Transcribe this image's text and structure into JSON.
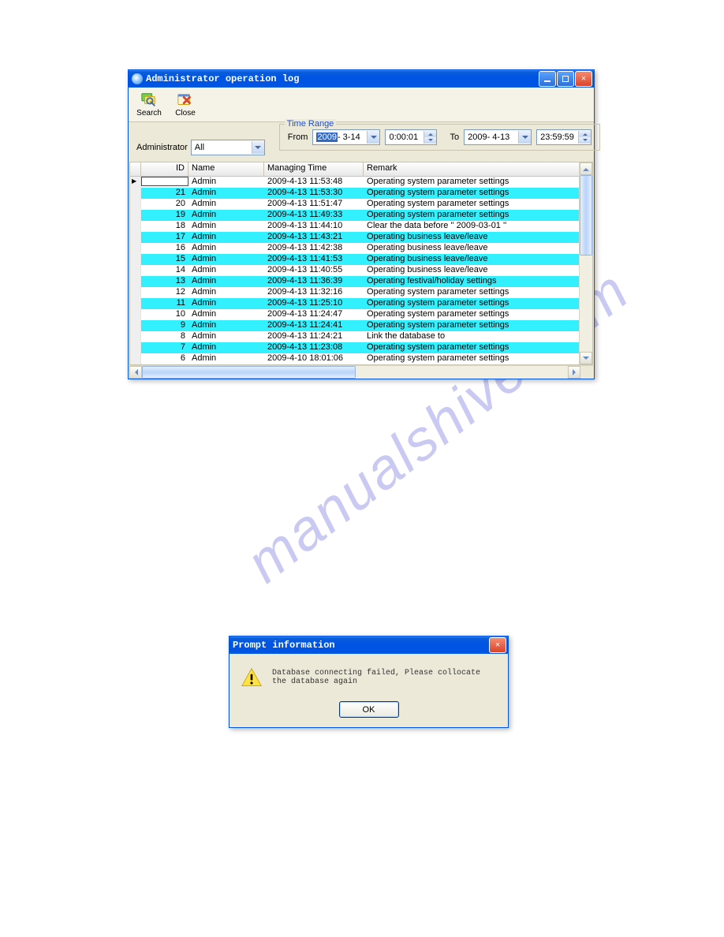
{
  "watermark": "manualshive.com",
  "mainWindow": {
    "title": "Administrator operation log",
    "toolbar": {
      "search": "Search",
      "close": "Close"
    },
    "filters": {
      "adminLabel": "Administrator",
      "adminValue": "All",
      "timeRangeLegend": "Time Range",
      "fromLabel": "From",
      "fromDate": "2009- 3-14",
      "fromDateSel": "2009",
      "fromTime": "0:00:01",
      "toLabel": "To",
      "toDate": "2009- 4-13",
      "toTime": "23:59:59"
    },
    "columns": {
      "id": "ID",
      "name": "Name",
      "time": "Managing Time",
      "remark": "Remark"
    },
    "rows": [
      {
        "id": "",
        "name": "Admin",
        "time": "2009-4-13 11:53:48",
        "remark": "Operating system parameter settings"
      },
      {
        "id": "21",
        "name": "Admin",
        "time": "2009-4-13 11:53:30",
        "remark": "Operating system parameter settings"
      },
      {
        "id": "20",
        "name": "Admin",
        "time": "2009-4-13 11:51:47",
        "remark": "Operating system parameter settings"
      },
      {
        "id": "19",
        "name": "Admin",
        "time": "2009-4-13 11:49:33",
        "remark": "Operating system parameter settings"
      },
      {
        "id": "18",
        "name": "Admin",
        "time": "2009-4-13 11:44:10",
        "remark": "Clear the data before '' 2009-03-01 ''"
      },
      {
        "id": "17",
        "name": "Admin",
        "time": "2009-4-13 11:43:21",
        "remark": "Operating business leave/leave"
      },
      {
        "id": "16",
        "name": "Admin",
        "time": "2009-4-13 11:42:38",
        "remark": "Operating business leave/leave"
      },
      {
        "id": "15",
        "name": "Admin",
        "time": "2009-4-13 11:41:53",
        "remark": "Operating business leave/leave"
      },
      {
        "id": "14",
        "name": "Admin",
        "time": "2009-4-13 11:40:55",
        "remark": "Operating business leave/leave"
      },
      {
        "id": "13",
        "name": "Admin",
        "time": "2009-4-13 11:36:39",
        "remark": "Operating festival/holiday settings"
      },
      {
        "id": "12",
        "name": "Admin",
        "time": "2009-4-13 11:32:16",
        "remark": "Operating system parameter settings"
      },
      {
        "id": "11",
        "name": "Admin",
        "time": "2009-4-13 11:25:10",
        "remark": "Operating system parameter settings"
      },
      {
        "id": "10",
        "name": "Admin",
        "time": "2009-4-13 11:24:47",
        "remark": "Operating system parameter settings"
      },
      {
        "id": "9",
        "name": "Admin",
        "time": "2009-4-13 11:24:41",
        "remark": "Operating system parameter settings"
      },
      {
        "id": "8",
        "name": "Admin",
        "time": "2009-4-13 11:24:21",
        "remark": "Link the database to"
      },
      {
        "id": "7",
        "name": "Admin",
        "time": "2009-4-13 11:23:08",
        "remark": "Operating system parameter settings"
      },
      {
        "id": "6",
        "name": "Admin",
        "time": "2009-4-10 18:01:06",
        "remark": "Operating system parameter settings"
      }
    ]
  },
  "dialog": {
    "title": "Prompt information",
    "message": "Database connecting failed, Please collocate the database again",
    "ok": "OK"
  }
}
